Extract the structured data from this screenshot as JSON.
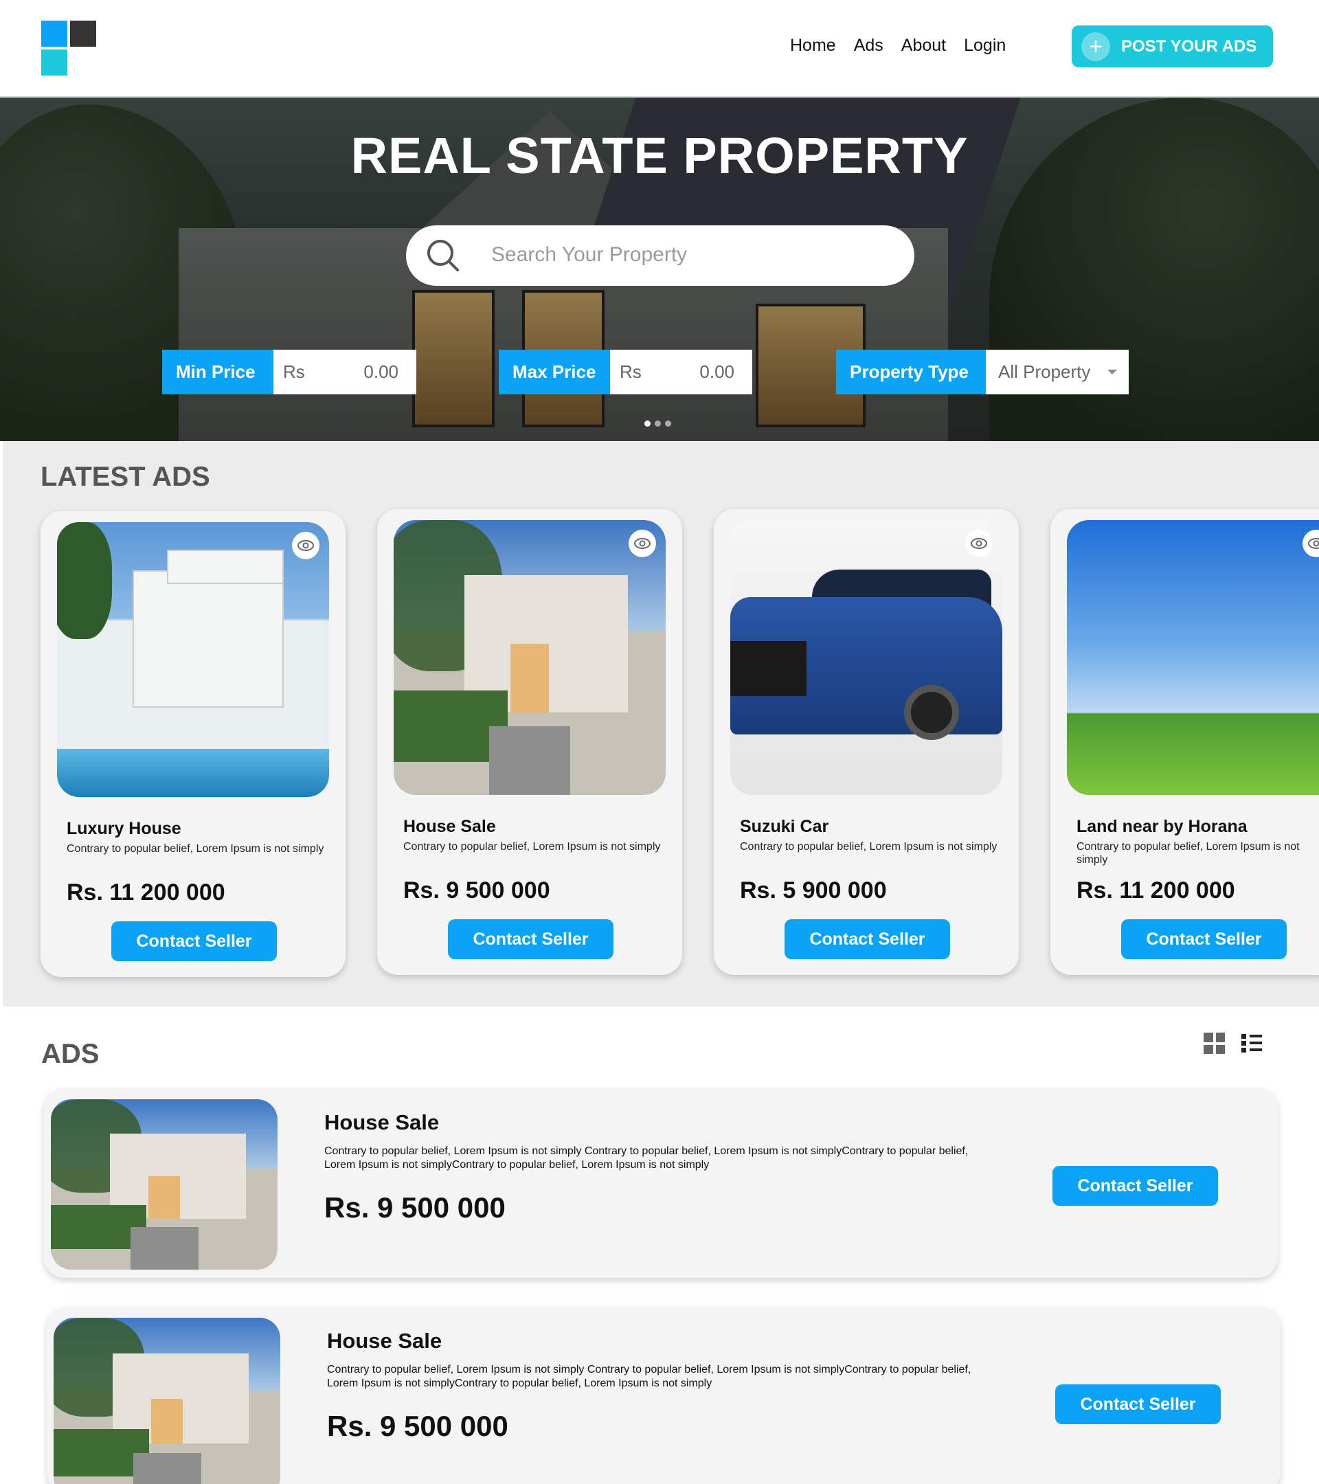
{
  "header": {
    "nav": [
      "Home",
      "Ads",
      "About",
      "Login"
    ],
    "post_button": "POST YOUR ADS"
  },
  "hero": {
    "title": "REAL STATE PROPERTY",
    "search_placeholder": "Search Your Property",
    "filters": {
      "min_price": {
        "label": "Min Price",
        "currency": "Rs",
        "value": "0.00"
      },
      "max_price": {
        "label": "Max Price",
        "currency": "Rs",
        "value": "0.00"
      },
      "property_type": {
        "label": "Property Type",
        "value": "All Property"
      }
    },
    "slider_dots": 3,
    "active_dot": 0
  },
  "latest": {
    "title": "LATEST ADS",
    "cards": [
      {
        "title": "Luxury House",
        "desc": "Contrary to popular belief, Lorem Ipsum is not simply",
        "price": "Rs. 11 200 000",
        "button": "Contact Seller",
        "image": "luxury-house-photo"
      },
      {
        "title": "House Sale",
        "desc": "Contrary to popular belief, Lorem Ipsum is not simply",
        "price": "Rs. 9 500 000",
        "button": "Contact Seller",
        "image": "house-photo"
      },
      {
        "title": "Suzuki Car",
        "desc": "Contrary to popular belief, Lorem Ipsum is not simply",
        "price": "Rs. 5 900 000",
        "button": "Contact Seller",
        "image": "suzuki-car-photo"
      },
      {
        "title": "Land near by Horana",
        "desc": "Contrary to popular belief, Lorem Ipsum is not simply",
        "price": "Rs. 11 200 000",
        "button": "Contact Seller",
        "image": "land-photo"
      }
    ]
  },
  "ads": {
    "title": "ADS",
    "items": [
      {
        "title": "House Sale",
        "desc": "Contrary to popular belief, Lorem Ipsum is not simply Contrary to popular belief, Lorem Ipsum is not simplyContrary to popular belief, Lorem Ipsum is not simplyContrary to popular belief, Lorem Ipsum is not simply",
        "price": "Rs. 9 500 000",
        "button": "Contact Seller"
      },
      {
        "title": "House Sale",
        "desc": "Contrary to popular belief, Lorem Ipsum is not simply Contrary to popular belief, Lorem Ipsum is not simplyContrary to popular belief, Lorem Ipsum is not simplyContrary to popular belief, Lorem Ipsum is not simply",
        "price": "Rs. 9 500 000",
        "button": "Contact Seller"
      }
    ]
  },
  "colors": {
    "primary": "#0aa3f5",
    "accent": "#1cc8dc",
    "dark": "#333333"
  }
}
